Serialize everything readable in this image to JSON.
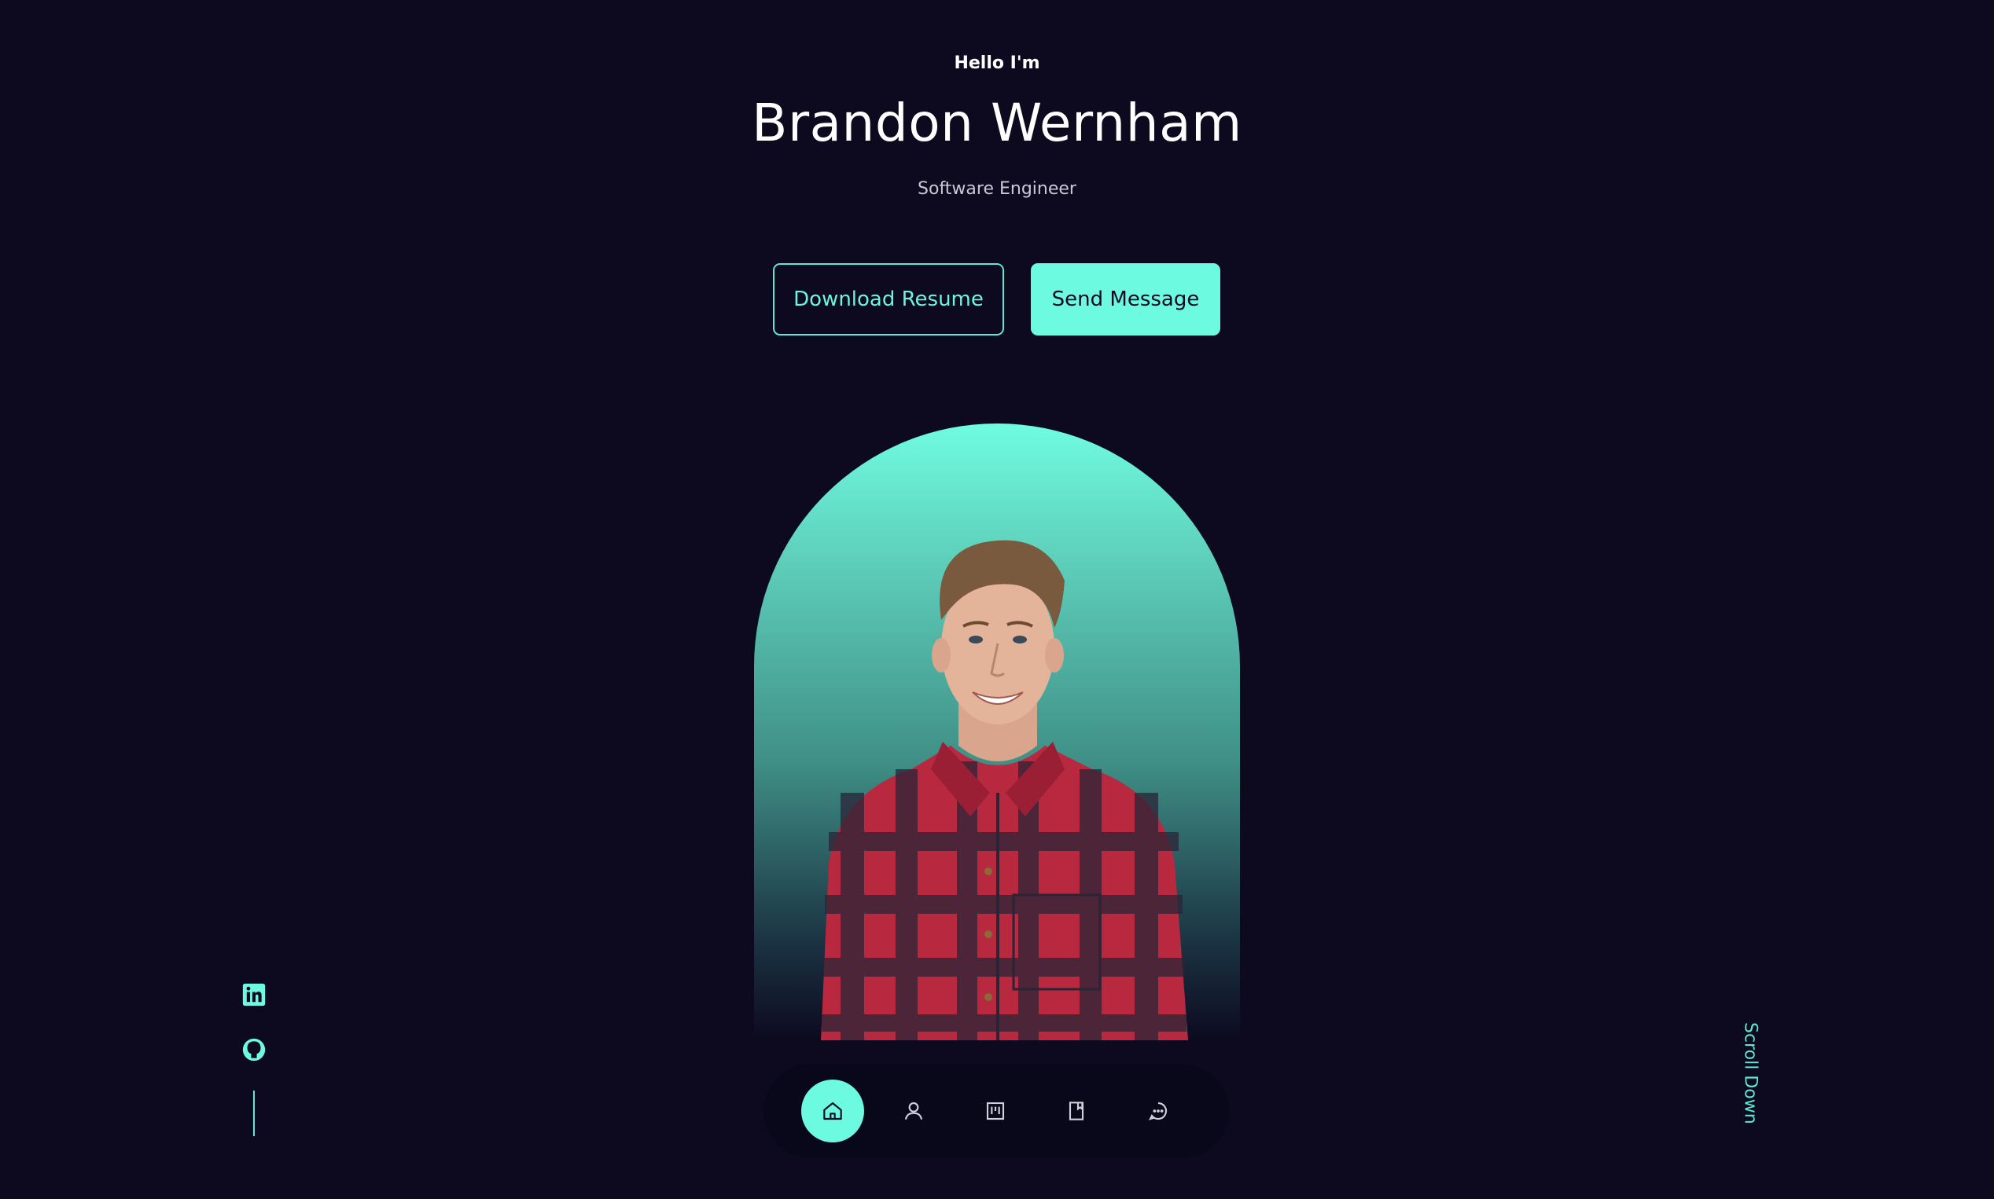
{
  "hero": {
    "greeting": "Hello I'm",
    "name": "Brandon Wernham",
    "role": "Software Engineer"
  },
  "buttons": {
    "download_resume": "Download Resume",
    "send_message": "Send Message"
  },
  "social": {
    "items": [
      {
        "icon": "linkedin-icon"
      },
      {
        "icon": "github-icon"
      }
    ]
  },
  "scroll": {
    "label": "Scroll Down"
  },
  "nav": {
    "items": [
      {
        "icon": "home-icon",
        "active": true
      },
      {
        "icon": "user-icon",
        "active": false
      },
      {
        "icon": "projects-icon",
        "active": false
      },
      {
        "icon": "book-icon",
        "active": false
      },
      {
        "icon": "chat-icon",
        "active": false
      }
    ]
  },
  "colors": {
    "background": "#0d0a20",
    "accent": "#6cfbe1",
    "nav_background": "#09071a"
  }
}
